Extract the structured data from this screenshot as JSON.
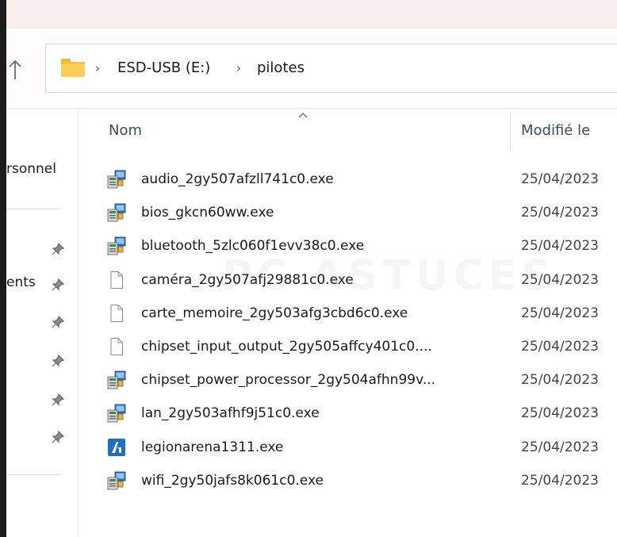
{
  "address_bar": {
    "breadcrumbs": [
      "ESD-USB (E:)",
      "pilotes"
    ],
    "folder_color": "#fbcd52"
  },
  "sidebar": {
    "items": [
      {
        "label": "rsonnel"
      },
      {
        "label": "ents"
      }
    ]
  },
  "columns": {
    "name": "Nom",
    "modified": "Modifié le"
  },
  "files": [
    {
      "name": "audio_2gy507afzll741c0.exe",
      "modified": "25/04/2023",
      "icon": "installer-icon"
    },
    {
      "name": "bios_gkcn60ww.exe",
      "modified": "25/04/2023",
      "icon": "installer-icon"
    },
    {
      "name": "bluetooth_5zlc060f1evv38c0.exe",
      "modified": "25/04/2023",
      "icon": "installer-icon"
    },
    {
      "name": "caméra_2gy507afj29881c0.exe",
      "modified": "25/04/2023",
      "icon": "file-icon"
    },
    {
      "name": "carte_memoire_2gy503afg3cbd6c0.exe",
      "modified": "25/04/2023",
      "icon": "file-icon"
    },
    {
      "name": "chipset_input_output_2gy505affcy401c0....",
      "modified": "25/04/2023",
      "icon": "file-icon"
    },
    {
      "name": "chipset_power_processor_2gy504afhn99v...",
      "modified": "25/04/2023",
      "icon": "installer-icon"
    },
    {
      "name": "lan_2gy503afhf9j51c0.exe",
      "modified": "25/04/2023",
      "icon": "installer-icon"
    },
    {
      "name": "legionarena1311.exe",
      "modified": "25/04/2023",
      "icon": "app-icon"
    },
    {
      "name": "wifi_2gy50jafs8k061c0.exe",
      "modified": "25/04/2023",
      "icon": "installer-icon"
    }
  ],
  "watermark": "PC ASTUCES"
}
